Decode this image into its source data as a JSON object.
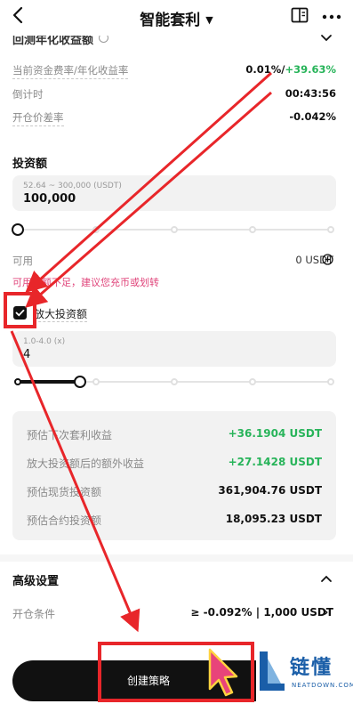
{
  "header": {
    "title": "智能套利",
    "back_icon": "chevron-left-icon",
    "guide_icon": "book-icon",
    "more_icon": "more-dots-icon"
  },
  "estimate": {
    "title": "回测年化收益额",
    "rows": [
      {
        "label": "当前资金费率/年化收益率",
        "value_a": "0.01%/",
        "value_b": "+39.63%"
      },
      {
        "label": "倒计时",
        "value": "00:43:56"
      },
      {
        "label": "开仓价差率",
        "value": "-0.042%"
      }
    ]
  },
  "investment": {
    "title": "投资额",
    "placeholder": "52.64 ~ 300,000 (USDT)",
    "value": "100,000",
    "slider_fraction": 0,
    "available_label": "可用",
    "available_value": "0 USDT",
    "warning": "可用余额不足，建议您充币或划转"
  },
  "amplify": {
    "checked": true,
    "label": "放大投资额",
    "placeholder": "1.0-4.0 (x)",
    "value": "4",
    "slider_fraction": 0.2
  },
  "summary": [
    {
      "label": "预估下次套利收益",
      "value": "+36.1904 USDT",
      "positive": true
    },
    {
      "label": "放大投资额后的额外收益",
      "value": "+27.1428 USDT",
      "positive": true
    },
    {
      "label": "预估现货投资额",
      "value": "361,904.76 USDT",
      "positive": false
    },
    {
      "label": "预估合约投资额",
      "value": "18,095.23 USDT",
      "positive": false
    }
  ],
  "advanced": {
    "title": "高级设置",
    "condition_label": "开仓条件",
    "condition_value": "≥ -0.092%  |  1,000 USDT"
  },
  "create_button": {
    "label": "创建策略"
  },
  "watermark": {
    "cn": "链懂",
    "en": "NEATDOWN.COM"
  },
  "colors": {
    "positive": "#28b45a",
    "warning": "#e0457b",
    "annotation": "#e8262a",
    "logo": "#1a5ea8"
  }
}
